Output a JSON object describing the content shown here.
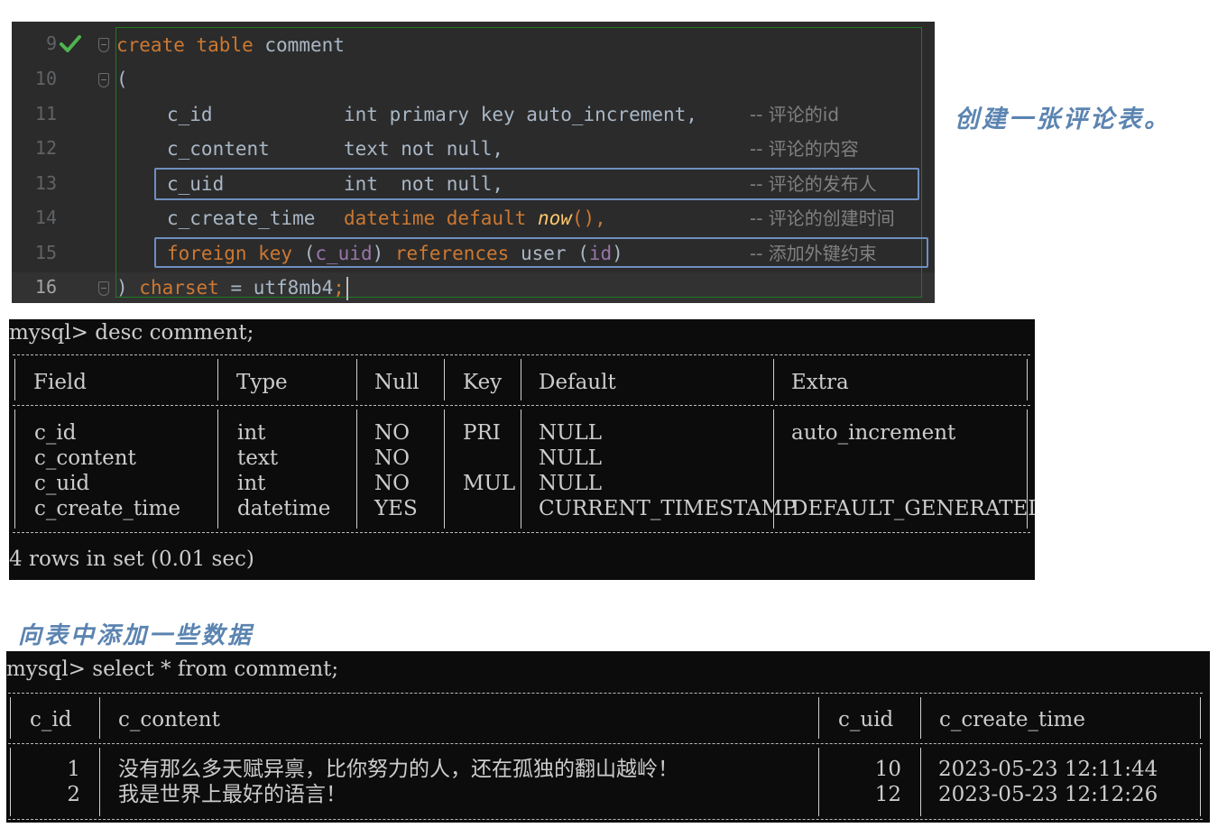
{
  "editor": {
    "line_numbers": [
      "9",
      "10",
      "11",
      "12",
      "13",
      "14",
      "15",
      "16"
    ],
    "line9": {
      "kw1": "create",
      "kw2": "table",
      "name": "comment"
    },
    "line10": {
      "text": "("
    },
    "line11": {
      "field": "c_id",
      "type": "int primary key auto_increment,",
      "comment": "-- 评论的id"
    },
    "line12": {
      "field": "c_content",
      "type": "text not null,",
      "comment": "-- 评论的内容"
    },
    "line13": {
      "field": "c_uid",
      "type": "int  not null,",
      "comment": "-- 评论的发布人"
    },
    "line14": {
      "field": "c_create_time",
      "type": "datetime default ",
      "fn": "now",
      "tail": "(),",
      "comment": "-- 评论的创建时间"
    },
    "line15": {
      "kw": "foreign key",
      "p1": " (",
      "field": "c_uid",
      "p2": ") ",
      "kw2": "references",
      "ref": " user ",
      "p3": "(",
      "field2": "id",
      "p4": ")",
      "comment": "-- 添加外键约束"
    },
    "line16": {
      "p1": ") ",
      "kw": "charset",
      "eq": " = utf8mb4",
      "semi": ";"
    }
  },
  "annotations": {
    "create_note": "创建一张评论表。",
    "insert_note": "向表中添加一些数据"
  },
  "desc_terminal": {
    "prompt": "mysql> desc comment;",
    "headers": [
      "Field",
      "Type",
      "Null",
      "Key",
      "Default",
      "Extra"
    ],
    "rows": [
      [
        "c_id",
        "int",
        "NO",
        "PRI",
        "NULL",
        "auto_increment"
      ],
      [
        "c_content",
        "text",
        "NO",
        "",
        "NULL",
        ""
      ],
      [
        "c_uid",
        "int",
        "NO",
        "MUL",
        "NULL",
        ""
      ],
      [
        "c_create_time",
        "datetime",
        "YES",
        "",
        "CURRENT_TIMESTAMP",
        "DEFAULT_GENERATED"
      ]
    ],
    "footer": "4 rows in set (0.01 sec)"
  },
  "select_terminal": {
    "prompt": "mysql> select * from comment;",
    "headers": [
      "c_id",
      "c_content",
      "c_uid",
      "c_create_time"
    ],
    "rows": [
      [
        "1",
        "没有那么多天赋异禀，比你努力的人，还在孤独的翻山越岭！",
        "10",
        "2023-05-23 12:11:44"
      ],
      [
        "2",
        "我是世界上最好的语言！",
        "12",
        "2023-05-23 12:12:26"
      ]
    ]
  },
  "colors": {
    "editor_bg": "#2b2b2b",
    "keyword": "#cc7832",
    "field": "#9876aa",
    "function": "#ffc66d",
    "comment": "#808080",
    "highlight_box": "#6d8fc0",
    "annotation": "#5b84b1",
    "terminal_bg": "#0c0c0c"
  },
  "icons": {
    "gutter_status": "checkmark-icon",
    "fold": "fold-marker-icon"
  }
}
